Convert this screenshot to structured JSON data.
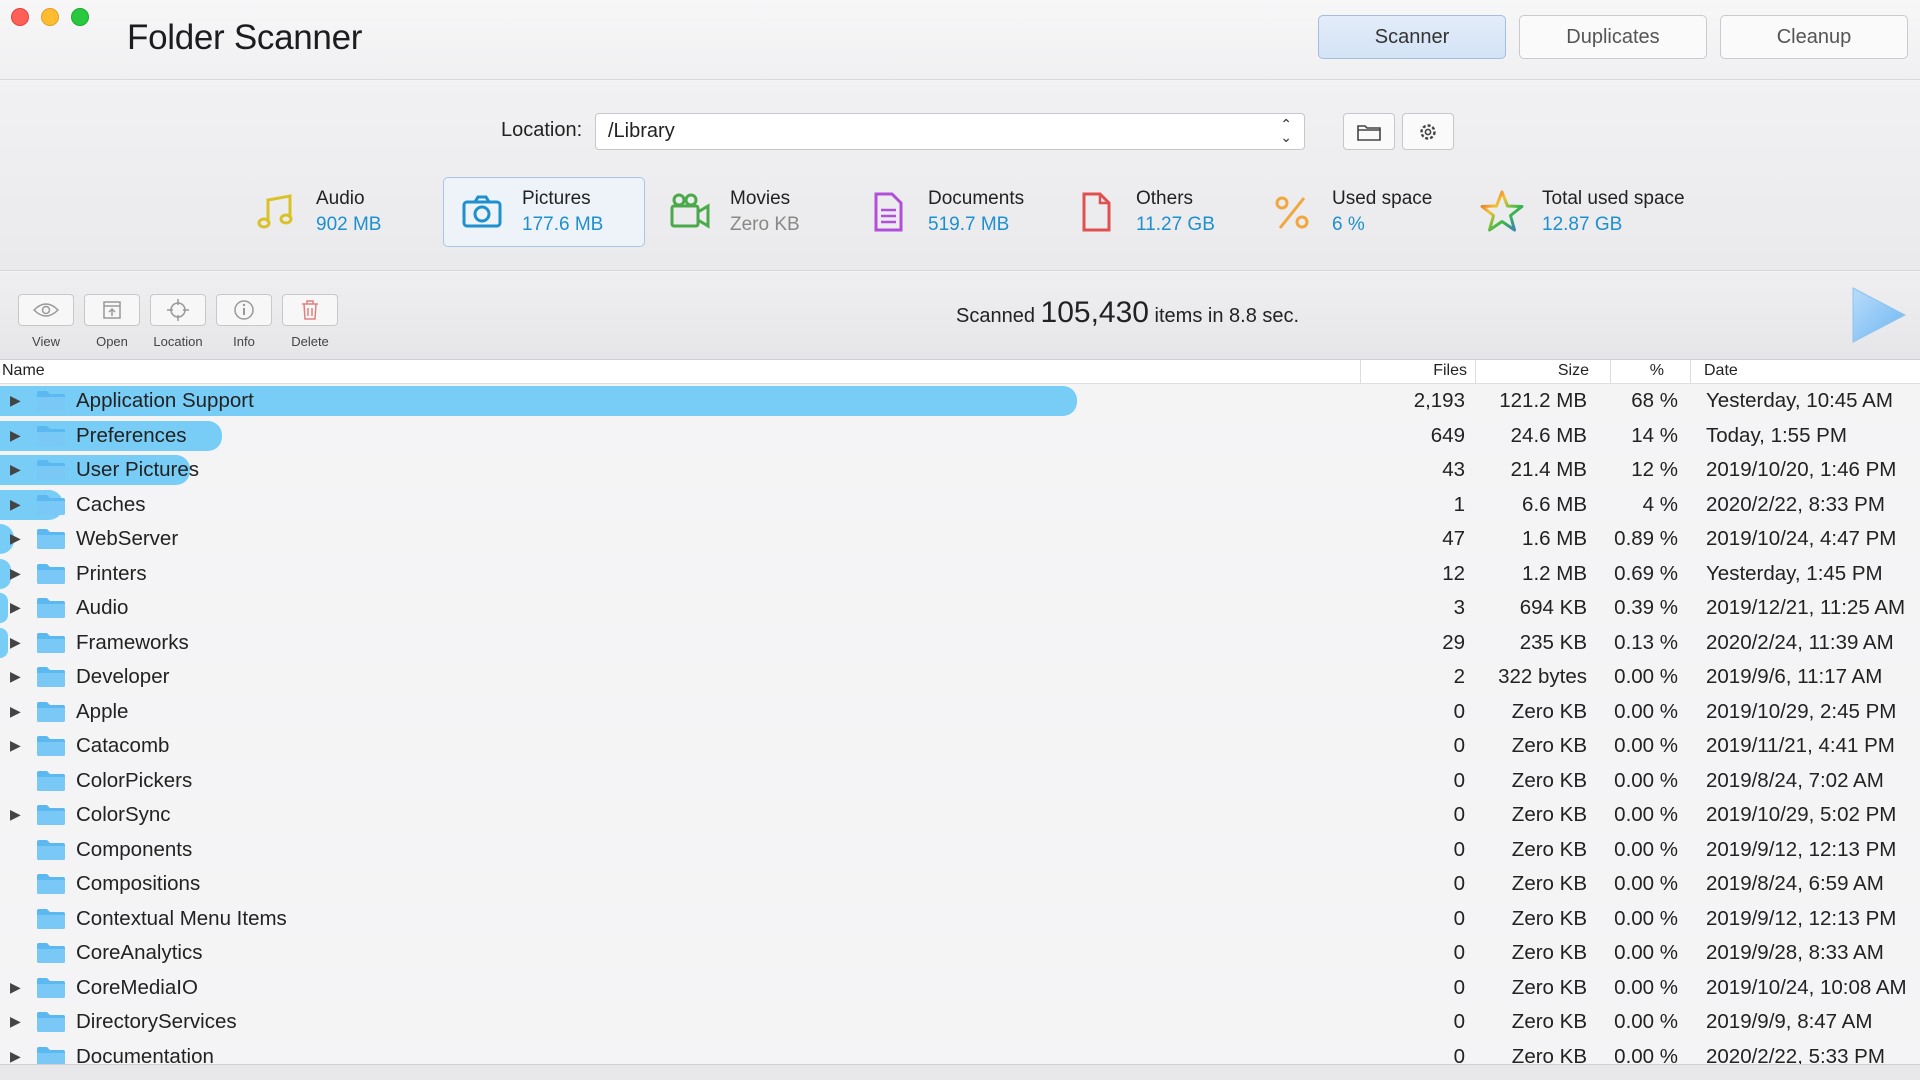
{
  "app": {
    "title": "Folder Scanner"
  },
  "modes": {
    "scanner": "Scanner",
    "duplicates": "Duplicates",
    "cleanup": "Cleanup"
  },
  "location": {
    "label": "Location:",
    "value": "/Library"
  },
  "categories": [
    {
      "name": "Audio",
      "value": "902 MB",
      "icon": "music-note-icon"
    },
    {
      "name": "Pictures",
      "value": "177.6 MB",
      "icon": "camera-icon"
    },
    {
      "name": "Movies",
      "value": "Zero KB",
      "icon": "video-camera-icon"
    },
    {
      "name": "Documents",
      "value": "519.7 MB",
      "icon": "document-icon"
    },
    {
      "name": "Others",
      "value": "11.27 GB",
      "icon": "file-icon"
    },
    {
      "name": "Used space",
      "value": "6 %",
      "icon": "percent-icon"
    },
    {
      "name": "Total used space",
      "value": "12.87 GB",
      "icon": "star-icon"
    }
  ],
  "toolbar": {
    "view": "View",
    "open": "Open",
    "location": "Location",
    "info": "Info",
    "delete": "Delete"
  },
  "status": {
    "prefix": "Scanned",
    "count": "105,430",
    "suffix": "items in 8.8 sec."
  },
  "columns": {
    "name": "Name",
    "files": "Files",
    "size": "Size",
    "pct": "%",
    "date": "Date"
  },
  "colors": {
    "accent": "#1e8fcf",
    "bar": "#78cdf7",
    "folder": "#5bb8f0"
  },
  "rows": [
    {
      "name": "Application Support",
      "files": "2,193",
      "size": "121.2 MB",
      "pct": "68 %",
      "date": "Yesterday, 10:45 AM",
      "share": 0.68,
      "expandable": true
    },
    {
      "name": "Preferences",
      "files": "649",
      "size": "24.6 MB",
      "pct": "14 %",
      "date": "Today, 1:55 PM",
      "share": 0.14,
      "expandable": true
    },
    {
      "name": "User Pictures",
      "files": "43",
      "size": "21.4 MB",
      "pct": "12 %",
      "date": "2019/10/20, 1:46 PM",
      "share": 0.12,
      "expandable": true
    },
    {
      "name": "Caches",
      "files": "1",
      "size": "6.6 MB",
      "pct": "4 %",
      "date": "2020/2/22, 8:33 PM",
      "share": 0.04,
      "expandable": true
    },
    {
      "name": "WebServer",
      "files": "47",
      "size": "1.6 MB",
      "pct": "0.89 %",
      "date": "2019/10/24, 4:47 PM",
      "share": 0.0089,
      "expandable": true
    },
    {
      "name": "Printers",
      "files": "12",
      "size": "1.2 MB",
      "pct": "0.69 %",
      "date": "Yesterday, 1:45 PM",
      "share": 0.0069,
      "expandable": true
    },
    {
      "name": "Audio",
      "files": "3",
      "size": "694 KB",
      "pct": "0.39 %",
      "date": "2019/12/21, 11:25 AM",
      "share": 0.0039,
      "expandable": true
    },
    {
      "name": "Frameworks",
      "files": "29",
      "size": "235 KB",
      "pct": "0.13 %",
      "date": "2020/2/24, 11:39 AM",
      "share": 0.0013,
      "expandable": true
    },
    {
      "name": "Developer",
      "files": "2",
      "size": "322 bytes",
      "pct": "0.00 %",
      "date": "2019/9/6, 11:17 AM",
      "share": 0,
      "expandable": true
    },
    {
      "name": "Apple",
      "files": "0",
      "size": "Zero KB",
      "pct": "0.00 %",
      "date": "2019/10/29, 2:45 PM",
      "share": 0,
      "expandable": true
    },
    {
      "name": "Catacomb",
      "files": "0",
      "size": "Zero KB",
      "pct": "0.00 %",
      "date": "2019/11/21, 4:41 PM",
      "share": 0,
      "expandable": true
    },
    {
      "name": "ColorPickers",
      "files": "0",
      "size": "Zero KB",
      "pct": "0.00 %",
      "date": "2019/8/24, 7:02 AM",
      "share": 0,
      "expandable": false
    },
    {
      "name": "ColorSync",
      "files": "0",
      "size": "Zero KB",
      "pct": "0.00 %",
      "date": "2019/10/29, 5:02 PM",
      "share": 0,
      "expandable": true
    },
    {
      "name": "Components",
      "files": "0",
      "size": "Zero KB",
      "pct": "0.00 %",
      "date": "2019/9/12, 12:13 PM",
      "share": 0,
      "expandable": false
    },
    {
      "name": "Compositions",
      "files": "0",
      "size": "Zero KB",
      "pct": "0.00 %",
      "date": "2019/8/24, 6:59 AM",
      "share": 0,
      "expandable": false
    },
    {
      "name": "Contextual Menu Items",
      "files": "0",
      "size": "Zero KB",
      "pct": "0.00 %",
      "date": "2019/9/12, 12:13 PM",
      "share": 0,
      "expandable": false
    },
    {
      "name": "CoreAnalytics",
      "files": "0",
      "size": "Zero KB",
      "pct": "0.00 %",
      "date": "2019/9/28, 8:33 AM",
      "share": 0,
      "expandable": false
    },
    {
      "name": "CoreMediaIO",
      "files": "0",
      "size": "Zero KB",
      "pct": "0.00 %",
      "date": "2019/10/24, 10:08 AM",
      "share": 0,
      "expandable": true
    },
    {
      "name": "DirectoryServices",
      "files": "0",
      "size": "Zero KB",
      "pct": "0.00 %",
      "date": "2019/9/9, 8:47 AM",
      "share": 0,
      "expandable": true
    },
    {
      "name": "Documentation",
      "files": "0",
      "size": "Zero KB",
      "pct": "0.00 %",
      "date": "2020/2/22, 5:33 PM",
      "share": 0,
      "expandable": true
    }
  ]
}
